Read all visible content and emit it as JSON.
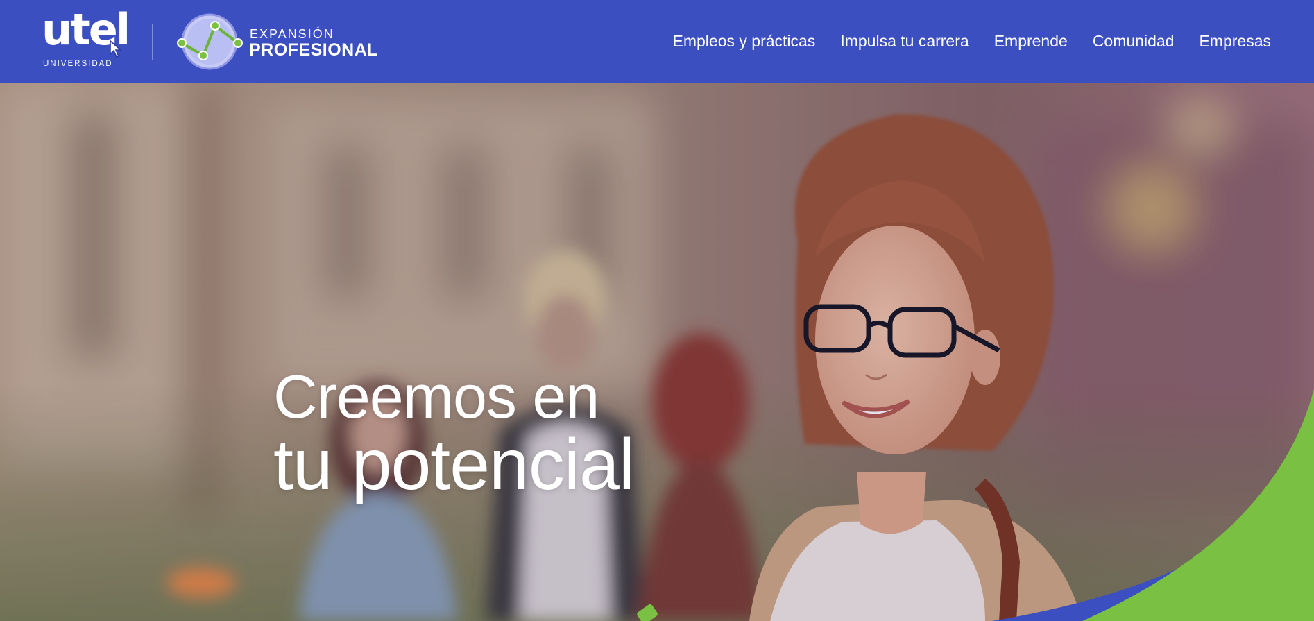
{
  "brand": {
    "utel_word": "utel",
    "utel_sub": "UNIVERSIDAD",
    "expansion_line1": "EXPANSIÓN",
    "expansion_line2": "PROFESIONAL"
  },
  "nav": {
    "items": [
      {
        "label": "Empleos y prácticas"
      },
      {
        "label": "Impulsa tu carrera"
      },
      {
        "label": "Emprende"
      },
      {
        "label": "Comunidad"
      },
      {
        "label": "Empresas"
      }
    ]
  },
  "hero": {
    "headline_line1": "Creemos en",
    "headline_line2": "tu potencial"
  },
  "colors": {
    "nav_bg": "#3c4fc1",
    "accent_green": "#7ac143",
    "accent_blue": "#3c4fc1"
  },
  "icons": [
    "cursor-arrow-icon",
    "expansion-emblem-icon"
  ]
}
